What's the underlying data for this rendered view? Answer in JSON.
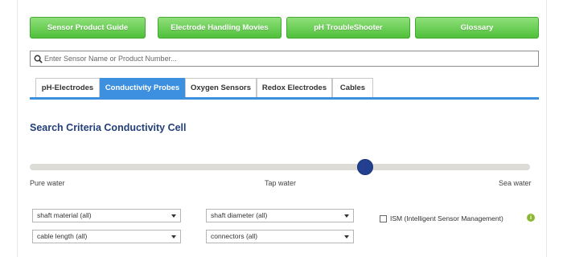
{
  "top_nav": {
    "buttons": [
      "Sensor Product Guide",
      "Electrode Handling Movies",
      "pH TroubleShooter",
      "Glossary"
    ]
  },
  "search": {
    "placeholder": "Enter Sensor Name or Product Number..."
  },
  "tabs": [
    "pH-Electrodes",
    "Conductivity Probes",
    "Oxygen Sensors",
    "Redox Electrodes",
    "Cables"
  ],
  "active_tab": "Conductivity Probes",
  "heading": "Search Criteria Conductivity Cell",
  "slider": {
    "labels": {
      "left": "Pure water",
      "middle": "Tap water",
      "right": "Sea water"
    },
    "value": 0.67
  },
  "filters": {
    "shaft_material": "shaft material (all)",
    "shaft_diameter": "shaft diameter (all)",
    "cable_length": "cable length (all)",
    "connectors": "connectors (all)"
  },
  "ism": {
    "label": "ISM (Intelligent Sensor Management)",
    "checked": false,
    "info_icon": "info-icon"
  },
  "colors": {
    "green": "#4fbf3a",
    "blue_accent": "#3d8fe0",
    "heading": "#233f7a",
    "knob": "#22408f",
    "info": "#8ab833"
  }
}
